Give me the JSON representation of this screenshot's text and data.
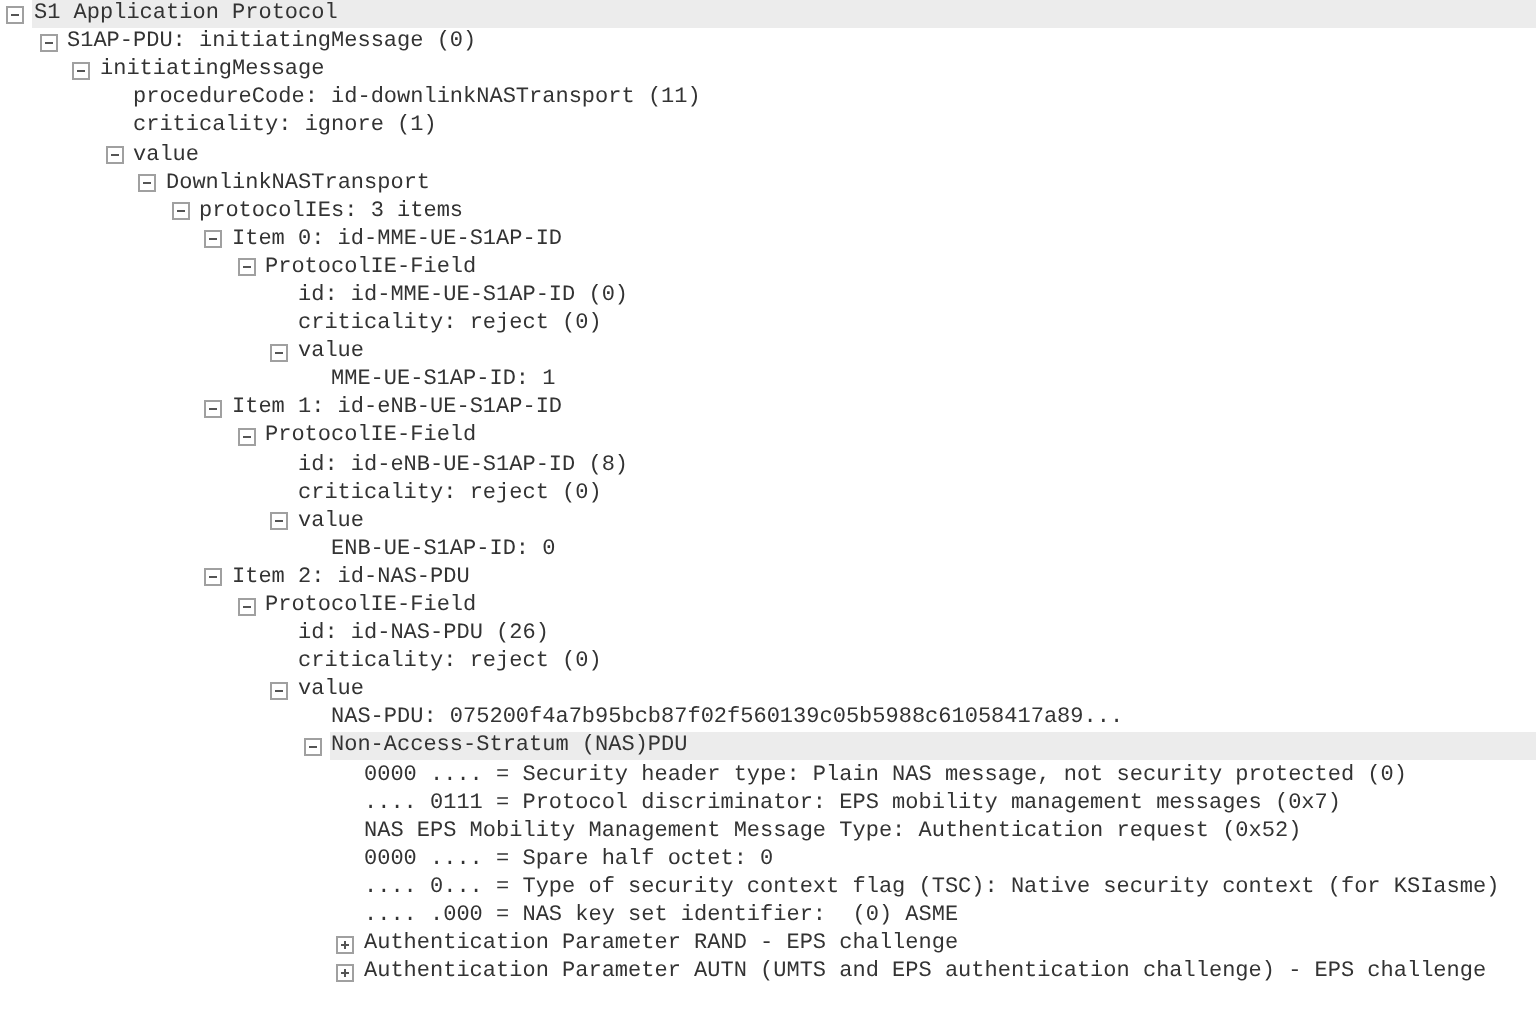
{
  "tree": [
    {
      "label": "S1 Application Protocol",
      "selected": true,
      "expanded": true,
      "children": [
        {
          "label": "S1AP-PDU: initiatingMessage (0)",
          "selected": false,
          "expanded": true,
          "children": [
            {
              "label": "initiatingMessage",
              "selected": false,
              "expanded": true,
              "children": [
                {
                  "label": "procedureCode: id-downlinkNASTransport (11)",
                  "selected": false
                },
                {
                  "label": "criticality: ignore (1)",
                  "selected": false
                },
                {
                  "label": "value",
                  "selected": false,
                  "expanded": true,
                  "children": [
                    {
                      "label": "DownlinkNASTransport",
                      "selected": false,
                      "expanded": true,
                      "children": [
                        {
                          "label": "protocolIEs: 3 items",
                          "selected": false,
                          "expanded": true,
                          "children": [
                            {
                              "label": "Item 0: id-MME-UE-S1AP-ID",
                              "selected": false,
                              "expanded": true,
                              "children": [
                                {
                                  "label": "ProtocolIE-Field",
                                  "selected": false,
                                  "expanded": true,
                                  "children": [
                                    {
                                      "label": "id: id-MME-UE-S1AP-ID (0)",
                                      "selected": false
                                    },
                                    {
                                      "label": "criticality: reject (0)",
                                      "selected": false
                                    },
                                    {
                                      "label": "value",
                                      "selected": false,
                                      "expanded": true,
                                      "children": [
                                        {
                                          "label": "MME-UE-S1AP-ID: 1",
                                          "selected": false
                                        }
                                      ]
                                    }
                                  ]
                                }
                              ]
                            },
                            {
                              "label": "Item 1: id-eNB-UE-S1AP-ID",
                              "selected": false,
                              "expanded": true,
                              "children": [
                                {
                                  "label": "ProtocolIE-Field",
                                  "selected": false,
                                  "expanded": true,
                                  "children": [
                                    {
                                      "label": "id: id-eNB-UE-S1AP-ID (8)",
                                      "selected": false
                                    },
                                    {
                                      "label": "criticality: reject (0)",
                                      "selected": false
                                    },
                                    {
                                      "label": "value",
                                      "selected": false,
                                      "expanded": true,
                                      "children": [
                                        {
                                          "label": "ENB-UE-S1AP-ID: 0",
                                          "selected": false
                                        }
                                      ]
                                    }
                                  ]
                                }
                              ]
                            },
                            {
                              "label": "Item 2: id-NAS-PDU",
                              "selected": false,
                              "expanded": true,
                              "children": [
                                {
                                  "label": "ProtocolIE-Field",
                                  "selected": false,
                                  "expanded": true,
                                  "children": [
                                    {
                                      "label": "id: id-NAS-PDU (26)",
                                      "selected": false
                                    },
                                    {
                                      "label": "criticality: reject (0)",
                                      "selected": false
                                    },
                                    {
                                      "label": "value",
                                      "selected": false,
                                      "expanded": true,
                                      "children": [
                                        {
                                          "label": "NAS-PDU: 075200f4a7b95bcb87f02f560139c05b5988c61058417a89...",
                                          "selected": false
                                        },
                                        {
                                          "label": "Non-Access-Stratum (NAS)PDU",
                                          "selected": true,
                                          "expanded": true,
                                          "children": [
                                            {
                                              "label": "0000 .... = Security header type: Plain NAS message, not security protected (0)",
                                              "selected": false
                                            },
                                            {
                                              "label": ".... 0111 = Protocol discriminator: EPS mobility management messages (0x7)",
                                              "selected": false
                                            },
                                            {
                                              "label": "NAS EPS Mobility Management Message Type: Authentication request (0x52)",
                                              "selected": false
                                            },
                                            {
                                              "label": "0000 .... = Spare half octet: 0",
                                              "selected": false
                                            },
                                            {
                                              "label": ".... 0... = Type of security context flag (TSC): Native security context (for KSIasme)",
                                              "selected": false
                                            },
                                            {
                                              "label": ".... .000 = NAS key set identifier:  (0) ASME",
                                              "selected": false
                                            },
                                            {
                                              "label": "Authentication Parameter RAND - EPS challenge",
                                              "selected": false,
                                              "expanded": false
                                            },
                                            {
                                              "label": "Authentication Parameter AUTN (UMTS and EPS authentication challenge) - EPS challenge",
                                              "selected": false,
                                              "expanded": false
                                            }
                                          ]
                                        }
                                      ]
                                    }
                                  ]
                                }
                              ]
                            }
                          ]
                        }
                      ]
                    }
                  ]
                }
              ]
            }
          ]
        }
      ]
    }
  ]
}
